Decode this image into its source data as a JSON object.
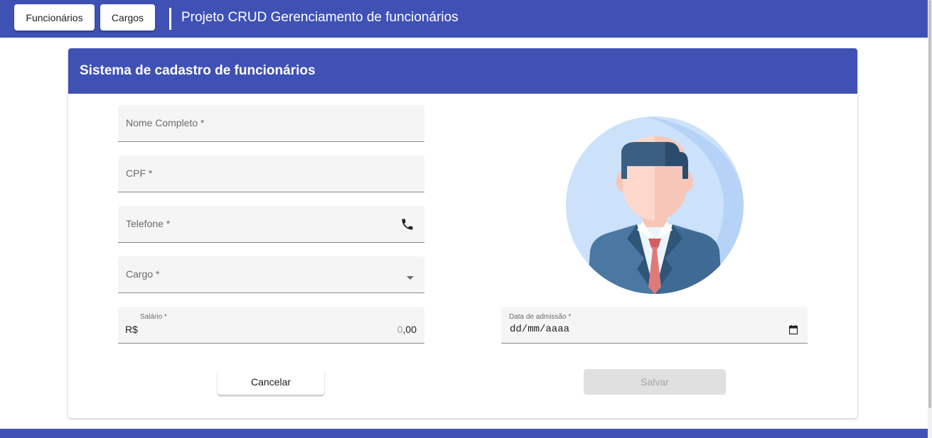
{
  "navbar": {
    "employees_button": "Funcionários",
    "roles_button": "Cargos",
    "title": "Projeto CRUD Gerenciamento de funcionários"
  },
  "card": {
    "title": "Sistema de cadastro de funcionários"
  },
  "form": {
    "full_name_label": "Nome Completo *",
    "cpf_label": "CPF *",
    "phone_label": "Telefone *",
    "role_label": "Cargo *",
    "salary_label": "Salário *",
    "salary_prefix": "R$",
    "salary_value_dim": "0",
    "salary_value": ",00",
    "admission_date_label": "Data de admissão *",
    "admission_date_value": "dd/mm/aaaa"
  },
  "actions": {
    "cancel_label": "Cancelar",
    "save_label": "Salvar"
  },
  "icons": {
    "phone": "phone-icon",
    "dropdown": "arrow-drop-down-icon",
    "calendar": "calendar-icon"
  },
  "colors": {
    "primary": "#3f51b5",
    "field_bg": "#f5f5f5",
    "avatar_bg": "#cce1fa"
  }
}
